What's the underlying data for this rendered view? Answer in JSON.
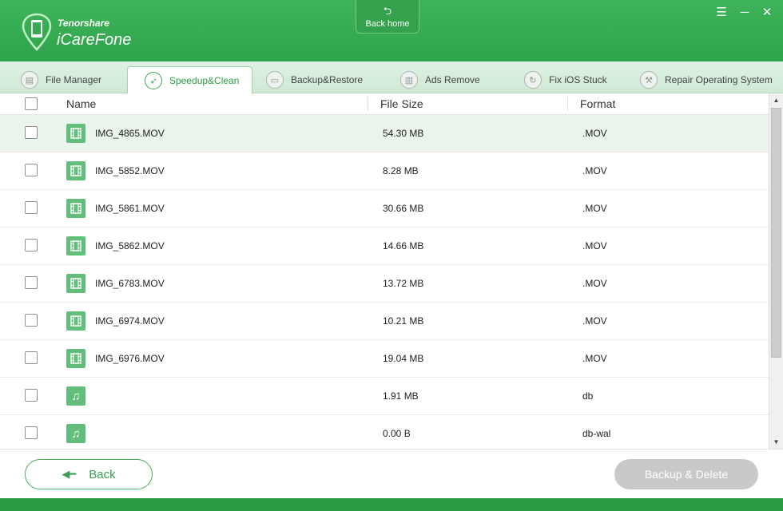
{
  "app": {
    "vendor": "Tenorshare",
    "name": "iCareFone"
  },
  "header": {
    "back_home_label": "Back home",
    "back_home_icon": "home-arrow-icon",
    "menu_icon": "menu-icon",
    "minimize_icon": "minimize-icon",
    "close_icon": "close-icon"
  },
  "tabs": [
    {
      "label": "File Manager",
      "icon": "file-manager-icon",
      "active": false
    },
    {
      "label": "Speedup&Clean",
      "icon": "rocket-icon",
      "active": true
    },
    {
      "label": "Backup&Restore",
      "icon": "backup-icon",
      "active": false
    },
    {
      "label": "Ads Remove",
      "icon": "trash-icon",
      "active": false
    },
    {
      "label": "Fix iOS Stuck",
      "icon": "refresh-icon",
      "active": false
    },
    {
      "label": "Repair Operating System",
      "icon": "wrench-icon",
      "active": false
    }
  ],
  "table": {
    "columns": {
      "name": "Name",
      "size": "File Size",
      "format": "Format"
    },
    "rows": [
      {
        "name": "IMG_4865.MOV",
        "size": "54.30 MB",
        "format": ".MOV",
        "icon": "video-icon",
        "selected": true
      },
      {
        "name": "IMG_5852.MOV",
        "size": "8.28 MB",
        "format": ".MOV",
        "icon": "video-icon"
      },
      {
        "name": "IMG_5861.MOV",
        "size": "30.66 MB",
        "format": ".MOV",
        "icon": "video-icon"
      },
      {
        "name": "IMG_5862.MOV",
        "size": "14.66 MB",
        "format": ".MOV",
        "icon": "video-icon"
      },
      {
        "name": "IMG_6783.MOV",
        "size": "13.72 MB",
        "format": ".MOV",
        "icon": "video-icon"
      },
      {
        "name": "IMG_6974.MOV",
        "size": "10.21 MB",
        "format": ".MOV",
        "icon": "video-icon"
      },
      {
        "name": "IMG_6976.MOV",
        "size": "19.04 MB",
        "format": ".MOV",
        "icon": "video-icon"
      },
      {
        "name": "",
        "size": "1.91 MB",
        "format": "db",
        "icon": "music-note-icon"
      },
      {
        "name": "",
        "size": "0.00 B",
        "format": "db-wal",
        "icon": "music-note-icon"
      }
    ]
  },
  "footer": {
    "back_label": "Back",
    "backup_delete_label": "Backup & Delete"
  },
  "colors": {
    "brand_green": "#2fa34b",
    "tab_bg": "#d8eedd",
    "selected_row": "#eaf4ec",
    "file_icon_green": "#63bd7b",
    "disabled_button": "#c9c9c9"
  }
}
